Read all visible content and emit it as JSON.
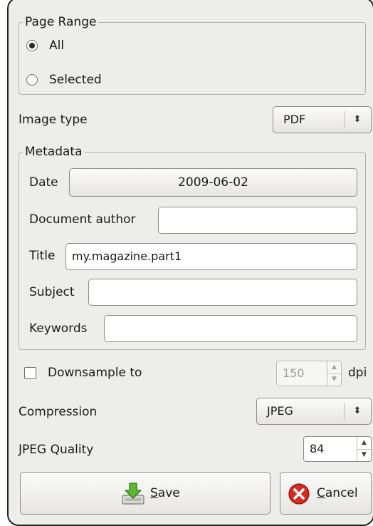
{
  "page_range": {
    "legend": "Page Range",
    "options": [
      {
        "label": "All",
        "checked": true
      },
      {
        "label": "Selected",
        "checked": false
      }
    ]
  },
  "image_type": {
    "label": "Image type",
    "value": "PDF"
  },
  "metadata": {
    "legend": "Metadata",
    "date_label": "Date",
    "date_value": "2009-06-02",
    "author_label": "Document author",
    "author_value": "",
    "title_label": "Title",
    "title_value": "my.magazine.part1",
    "subject_label": "Subject",
    "subject_value": "",
    "keywords_label": "Keywords",
    "keywords_value": ""
  },
  "downsample": {
    "label": "Downsample to",
    "checked": false,
    "value": "150",
    "unit": "dpi"
  },
  "compression": {
    "label": "Compression",
    "value": "JPEG"
  },
  "jpeg_quality": {
    "label": "JPEG Quality",
    "value": "84"
  },
  "buttons": {
    "save_mnemonic": "S",
    "save_rest": "ave",
    "cancel_mnemonic": "C",
    "cancel_rest": "ancel"
  },
  "icons": {
    "save": "save-download-icon",
    "cancel": "cancel-x-icon"
  },
  "colors": {
    "save_icon_green": "#5cb82c",
    "cancel_icon_red": "#d42a1f"
  }
}
